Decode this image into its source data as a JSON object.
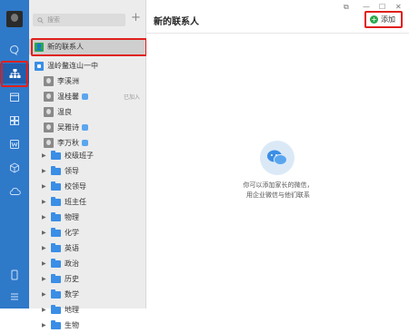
{
  "search": {
    "placeholder": "搜索"
  },
  "panel": {
    "new_contacts": "新的联系人",
    "org": "温岭鳌连山一中",
    "people": [
      {
        "name": "李溪洲",
        "badge": false,
        "tag": ""
      },
      {
        "name": "温桂馨",
        "badge": true,
        "tag": "已加入"
      },
      {
        "name": "温良",
        "badge": false,
        "tag": ""
      },
      {
        "name": "吴雅诗",
        "badge": true,
        "tag": ""
      },
      {
        "name": "李万秋",
        "badge": true,
        "tag": ""
      }
    ],
    "groups": [
      "校级班子",
      "领导",
      "校领导",
      "班主任",
      "物理",
      "化学",
      "英语",
      "政治",
      "历史",
      "数学",
      "地理",
      "生物"
    ]
  },
  "main": {
    "title": "新的联系人",
    "add_label": "添加",
    "hint_line1": "你可以添加家长的微信，",
    "hint_line2": "用企业微信与他们联系"
  },
  "colors": {
    "rail": "#2f79c9",
    "highlight": "#e0201c",
    "green": "#2aa84a"
  },
  "icons": [
    "message-icon",
    "contacts-icon",
    "calendar-icon",
    "grid-icon",
    "document-icon",
    "cube-icon",
    "cloud-icon",
    "more-icon"
  ]
}
